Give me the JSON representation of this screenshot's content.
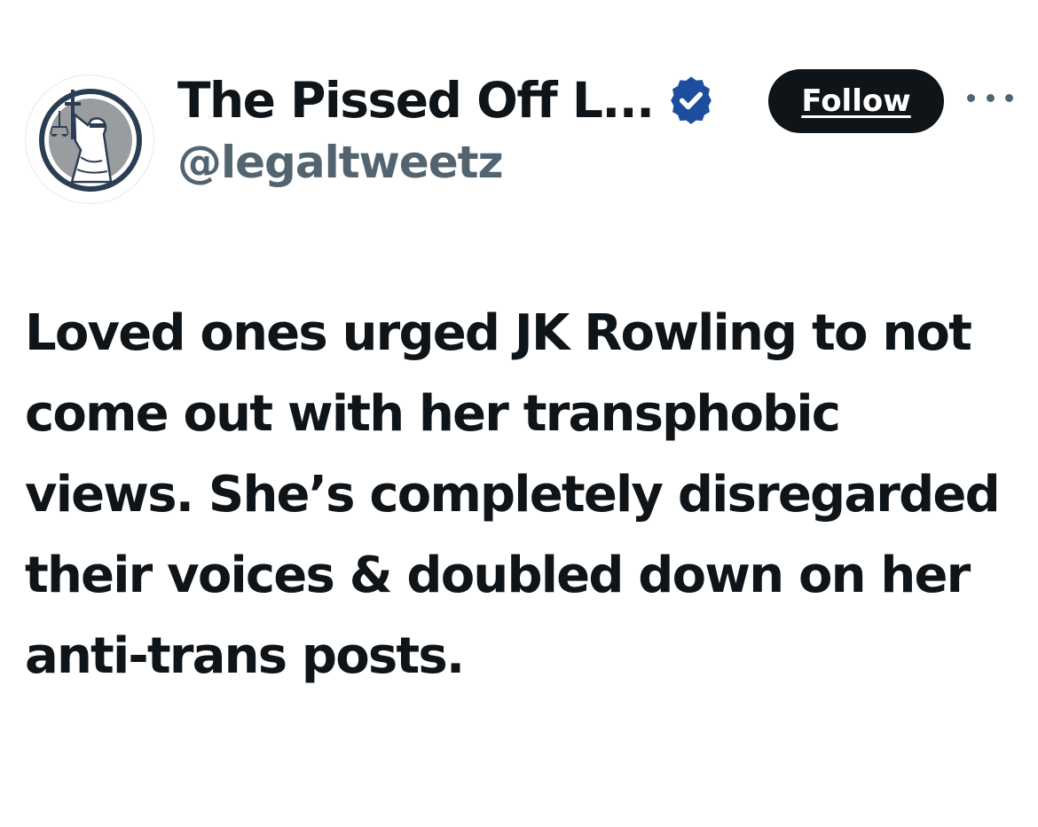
{
  "author": {
    "display_name": "The Pissed Off L...",
    "handle": "@legaltweetz",
    "verified": true,
    "avatar_icon": "lady-justice-icon",
    "verified_icon": "verified-badge-icon"
  },
  "actions": {
    "follow_label": "Follow",
    "more_icon": "more-options-icon"
  },
  "post": {
    "text": "Loved ones urged JK Rowling to not come out with her transphobic views. She’s completely disregarded their voices & doubled down on her anti-trans posts."
  },
  "colors": {
    "text_primary": "#0f1419",
    "text_secondary": "#536471",
    "follow_bg": "#0f1419",
    "verified_blue": "#1d4e9e",
    "avatar_gray": "#9a9d9f",
    "avatar_navy": "#2b3d52"
  }
}
